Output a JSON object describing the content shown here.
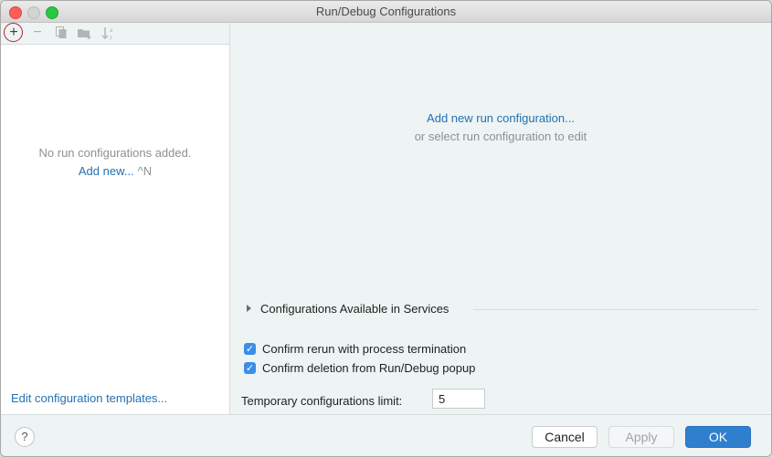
{
  "window": {
    "title": "Run/Debug Configurations"
  },
  "toolbar": {
    "add_icon": "+",
    "remove_icon": "−",
    "copy_icon": "copy",
    "folder_icon": "new-folder",
    "sort_icon": "sort-az"
  },
  "left_panel": {
    "empty_message": "No run configurations added.",
    "add_new_label": "Add new...",
    "add_new_shortcut": "^N",
    "edit_templates_label": "Edit configuration templates..."
  },
  "right_panel": {
    "add_new_link": "Add new run configuration...",
    "select_hint": "or select run configuration to edit",
    "services_section_label": "Configurations Available in Services",
    "checkboxes": [
      {
        "label": "Confirm rerun with process termination",
        "checked": true
      },
      {
        "label": "Confirm deletion from Run/Debug popup",
        "checked": true
      }
    ],
    "limit_label": "Temporary configurations limit:",
    "limit_value": "5"
  },
  "footer": {
    "help_label": "?",
    "cancel_label": "Cancel",
    "apply_label": "Apply",
    "ok_label": "OK"
  }
}
